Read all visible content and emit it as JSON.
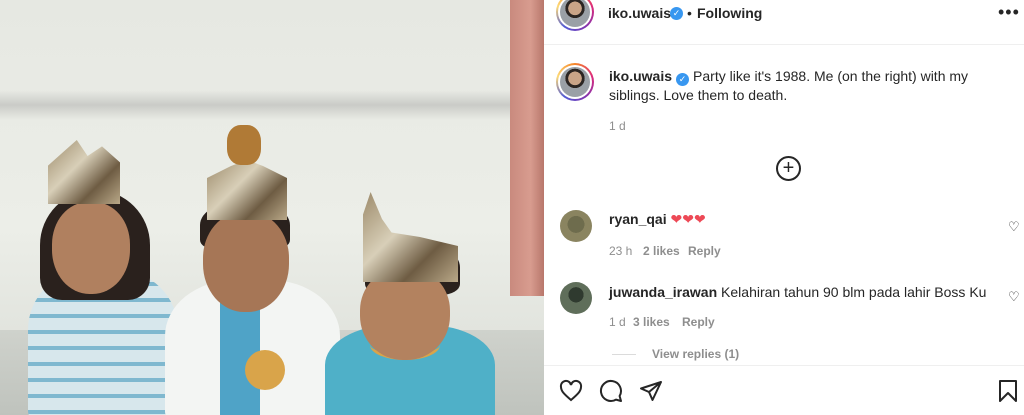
{
  "post": {
    "username": "iko.uwais",
    "separator": "•",
    "follow_state": "Following",
    "more_icon": "more-horizontal-icon",
    "caption_user": "iko.uwais",
    "caption_text": "Party like it's 1988. Me (on the right) with my siblings. Love them to death.",
    "caption_time": "1 d",
    "load_more_icon": "plus-circle-icon"
  },
  "comments": [
    {
      "user": "ryan_qai",
      "text": "❤❤❤",
      "time": "23 h",
      "likes": "2 likes",
      "reply": "Reply"
    },
    {
      "user": "juwanda_irawan",
      "text": "Kelahiran tahun 90 blm pada lahir Boss Ku",
      "time": "1 d",
      "likes": "3 likes",
      "reply": "Reply"
    }
  ],
  "view_replies": "View replies (1)",
  "actions": {
    "like_icon": "heart-icon",
    "comment_icon": "comment-icon",
    "share_icon": "send-icon",
    "save_icon": "bookmark-icon"
  },
  "colors": {
    "verified": "#3897f0",
    "heart": "#ed4956",
    "muted": "#8e8e8e"
  }
}
